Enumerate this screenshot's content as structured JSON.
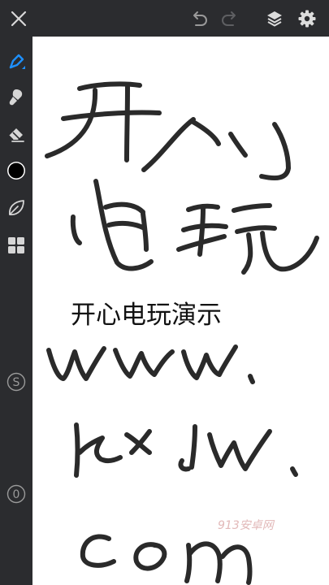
{
  "toolbar": {
    "close_icon": "close-icon",
    "undo_icon": "undo-icon",
    "redo_icon": "redo-icon",
    "layers_icon": "layers-icon",
    "settings_icon": "gear-icon"
  },
  "sidebar": {
    "tools": [
      {
        "name": "pen-tool",
        "icon": "pen-icon",
        "active": true
      },
      {
        "name": "brush-tool",
        "icon": "brush-icon"
      },
      {
        "name": "eraser-tool",
        "icon": "eraser-icon"
      },
      {
        "name": "color-picker",
        "icon": "color-swatch",
        "color": "#000000"
      },
      {
        "name": "shape-tool",
        "icon": "leaf-icon"
      },
      {
        "name": "gallery-tool",
        "icon": "grid-icon"
      }
    ],
    "size_label": "S",
    "opacity_label": "0"
  },
  "canvas": {
    "typed_text": "开心电玩演示",
    "watermark": "913安卓网",
    "handwriting": [
      "开心",
      "电玩",
      "www.",
      "kxdw.",
      "com"
    ]
  },
  "colors": {
    "chrome": "#2b2c2f",
    "accent": "#1e90ff",
    "icon": "#cfcfcf",
    "ink": "#2a2a2a"
  }
}
